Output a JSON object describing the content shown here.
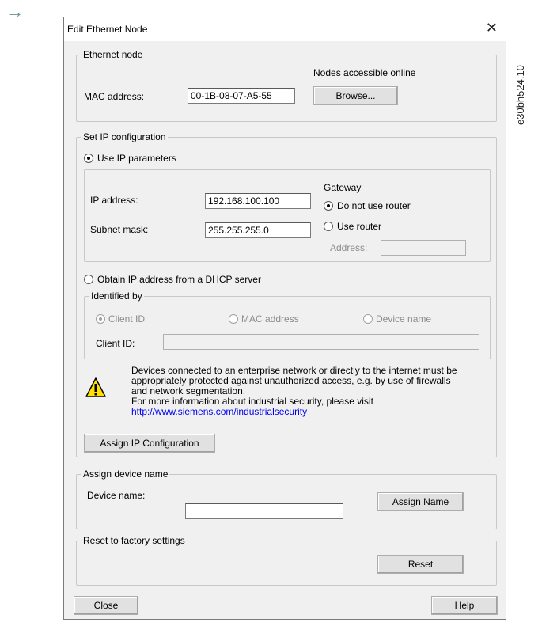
{
  "side_arrow": "→",
  "figure_id": "e30bh524.10",
  "dialog": {
    "title": "Edit Ethernet Node",
    "close_glyph": "✕"
  },
  "ethernet_node": {
    "legend": "Ethernet node",
    "nodes_online_label": "Nodes accessible online",
    "mac_label": "MAC address:",
    "mac_value": "00-1B-08-07-A5-55",
    "browse_button": "Browse..."
  },
  "ip_config": {
    "legend": "Set IP configuration",
    "use_ip_params_label": "Use IP parameters",
    "ip_address_label": "IP address:",
    "ip_address_value": "192.168.100.100",
    "subnet_mask_label": "Subnet mask:",
    "subnet_mask_value": "255.255.255.0",
    "gateway_label": "Gateway",
    "do_not_use_router_label": "Do not use router",
    "use_router_label": "Use router",
    "router_address_label": "Address:",
    "router_address_value": "",
    "dhcp_label": "Obtain IP address from a DHCP server",
    "identified_by": {
      "legend": "Identified by",
      "client_id_label": "Client ID",
      "mac_address_label": "MAC address",
      "device_name_label": "Device name",
      "client_id_field_label": "Client ID:",
      "client_id_value": ""
    },
    "warning": {
      "line1": "Devices connected to an enterprise network or directly to the internet must be",
      "line2": "appropriately protected against unauthorized access, e.g. by use of firewalls",
      "line3": "and network segmentation.",
      "line4": "For more information about industrial security, please visit",
      "link": "http://www.siemens.com/industrialsecurity"
    },
    "assign_ip_button": "Assign IP Configuration"
  },
  "device_name": {
    "legend": "Assign device name",
    "label": "Device name:",
    "value": "",
    "assign_button": "Assign Name"
  },
  "factory_reset": {
    "legend": "Reset to factory settings",
    "reset_button": "Reset"
  },
  "footer": {
    "close_button": "Close",
    "help_button": "Help"
  },
  "colors": {
    "dialog_bg": "#f0f0f0",
    "button_bg": "#e1e1e1",
    "link": "#0000ee",
    "warning_yellow": "#ffe000"
  }
}
